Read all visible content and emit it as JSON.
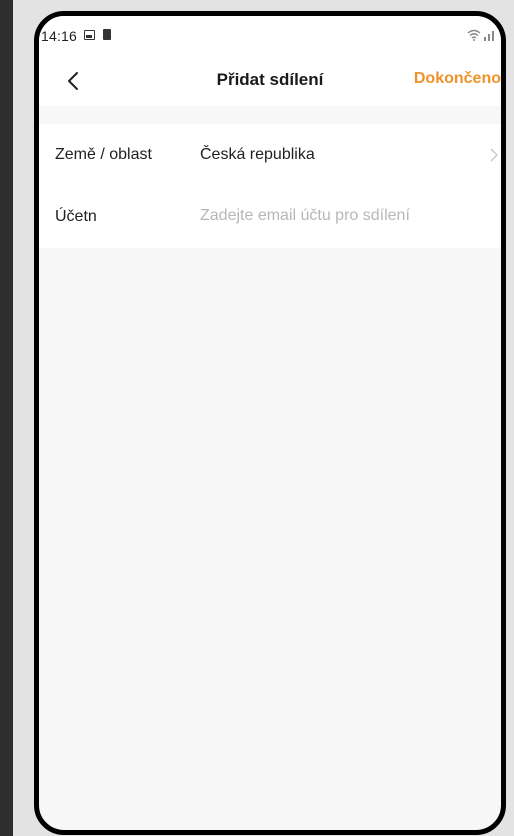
{
  "status_bar": {
    "time": "14:16"
  },
  "nav": {
    "title": "Přidat sdílení",
    "done_label": "Dokončeno"
  },
  "form": {
    "region_label": "Země / oblast",
    "region_value": "Česká republika",
    "account_label": "Účetn",
    "account_placeholder": "Zadejte email účtu pro sdílení",
    "account_value": ""
  },
  "colors": {
    "accent": "#f0922b",
    "background": "#f7f7f7"
  },
  "icons": [
    "gallery-icon",
    "battery-icon",
    "wifi-icon",
    "signal-icon",
    "back-arrow-icon",
    "chevron-right-icon"
  ]
}
